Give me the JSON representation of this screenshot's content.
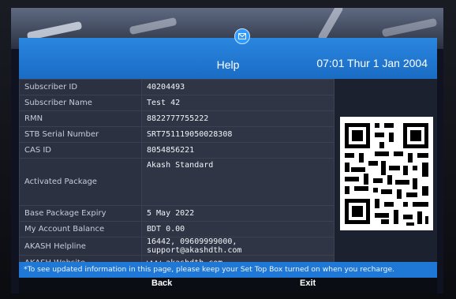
{
  "header": {
    "title": "Help",
    "datetime": "07:01 Thur 1 Jan 2004",
    "icon": "mail-icon"
  },
  "rows": [
    {
      "label": "Subscriber ID",
      "value": "40204493"
    },
    {
      "label": "Subscriber Name",
      "value": "Test 42"
    },
    {
      "label": "RMN",
      "value": "8822777755222"
    },
    {
      "label": "STB Serial Number",
      "value": "SRT751119050028308"
    },
    {
      "label": "CAS ID",
      "value": "8054856221"
    },
    {
      "label": "Activated Package",
      "value": "Akash Standard"
    },
    {
      "label": "Base Package Expiry",
      "value": "5 May 2022"
    },
    {
      "label": "My Account Balance",
      "value": "BDT 0.00"
    },
    {
      "label": "AKASH Helpline",
      "value": "16442, 09609999000, support@akashdth.com"
    },
    {
      "label": "AKASH Website",
      "value": "www.akashdth.com"
    }
  ],
  "footer": {
    "note": "*To see updated information in this page, please keep your Set Top Box turned on when you recharge.",
    "back_label": "Back",
    "exit_label": "Exit"
  },
  "colors": {
    "header_blue": "#1a6cc4",
    "footer_blue": "#1f78d6"
  }
}
